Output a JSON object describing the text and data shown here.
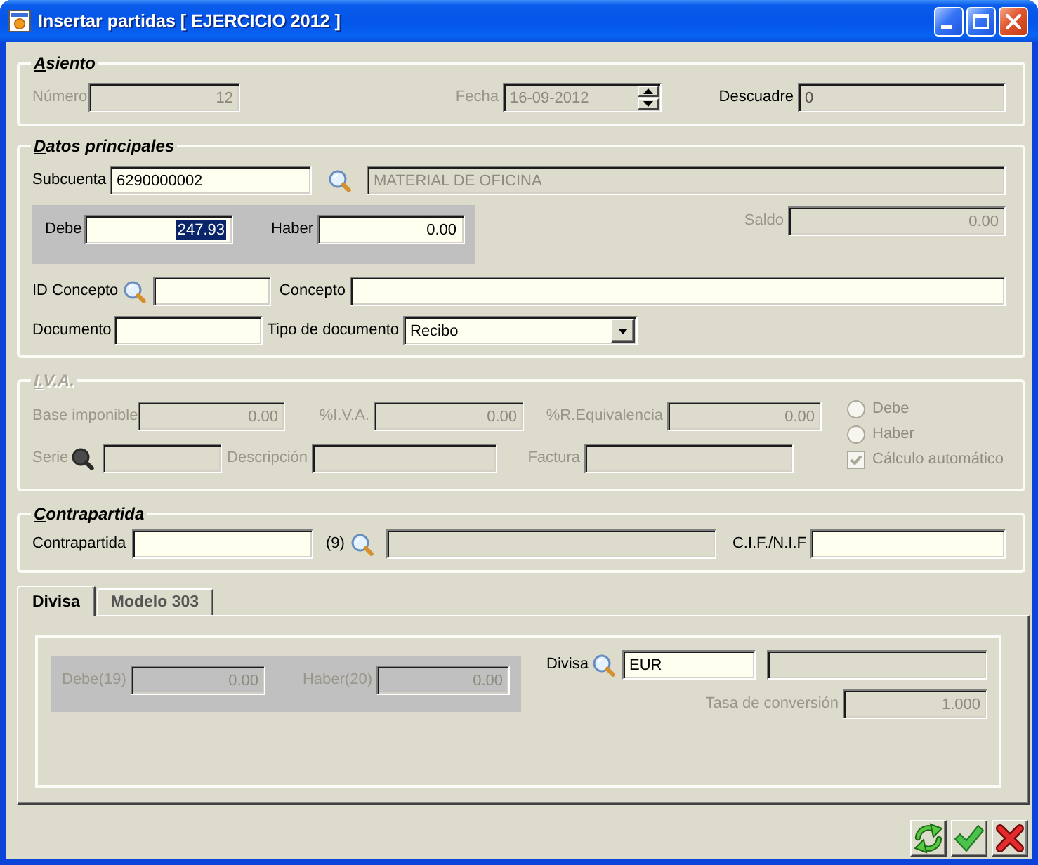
{
  "window": {
    "title": "Insertar partidas [ EJERCICIO 2012 ]"
  },
  "asiento": {
    "legend": "Asiento",
    "disabled": false,
    "numero": {
      "label": "Número",
      "value": "12",
      "disabled": true
    },
    "fecha": {
      "label": "Fecha",
      "value": "16-09-2012",
      "disabled": true
    },
    "descuadre": {
      "label": "Descuadre",
      "value": "0",
      "disabled": false,
      "read_only": true
    }
  },
  "datos": {
    "legend": "Datos principales",
    "disabled": false,
    "subcuenta": {
      "label": "Subcuenta",
      "value": "6290000002",
      "disabled": false
    },
    "subcuenta_nombre": {
      "value": "MATERIAL DE OFICINA",
      "disabled": true
    },
    "debe": {
      "label": "Debe",
      "value": "247.93",
      "disabled": false,
      "text_selected": true
    },
    "haber": {
      "label": "Haber",
      "value": "0.00",
      "disabled": false,
      "text_selected": false
    },
    "saldo": {
      "label": "Saldo",
      "value": "0.00",
      "disabled": true
    },
    "id_concepto": {
      "label": "ID Concepto",
      "disabled": false
    },
    "concepto": {
      "label": "Concepto",
      "disabled": false
    },
    "documento": {
      "label": "Documento",
      "disabled": false
    },
    "tipo_documento": {
      "label": "Tipo de documento",
      "value": "Recibo",
      "disabled": false
    }
  },
  "iva": {
    "legend": "I.V.A.",
    "disabled": true,
    "base_imponible": {
      "label": "Base imponible",
      "value": "0.00",
      "disabled": true
    },
    "porc_iva": {
      "label": "%I.V.A.",
      "value": "0.00",
      "disabled": true
    },
    "porc_equivalencia": {
      "label": "%R.Equivalencia",
      "value": "0.00",
      "disabled": true
    },
    "serie": {
      "label": "Serie",
      "disabled": true
    },
    "descripcion": {
      "label": "Descripción",
      "disabled": true
    },
    "factura": {
      "label": "Factura",
      "disabled": true
    },
    "radios": [
      {
        "label": "Debe",
        "selected": false,
        "disabled": true
      },
      {
        "label": "Haber",
        "selected": false,
        "disabled": true
      }
    ],
    "calculo_automatico": {
      "label": "Cálculo automático",
      "checked": true,
      "disabled": true
    }
  },
  "contrapartida": {
    "legend": "Contrapartida",
    "disabled": false,
    "cuenta": {
      "label": "Contrapartida",
      "disabled": false
    },
    "count": "(9)",
    "nombre": {
      "disabled": true
    },
    "cif_nif": {
      "label": "C.I.F./N.I.F",
      "disabled": false
    }
  },
  "tabs": [
    {
      "label": "Divisa",
      "selected": true
    },
    {
      "label": "Modelo 303",
      "selected": false
    }
  ],
  "divisa": {
    "debe": {
      "label": "Debe(19)",
      "value": "0.00",
      "disabled": true
    },
    "haber": {
      "label": "Haber(20)",
      "value": "0.00",
      "disabled": true
    },
    "divisa": {
      "label": "Divisa",
      "value": "EUR",
      "disabled": false
    },
    "nombre": {
      "disabled": true
    },
    "tasa": {
      "label": "Tasa de conversión",
      "value": "1.000",
      "disabled": true
    }
  }
}
